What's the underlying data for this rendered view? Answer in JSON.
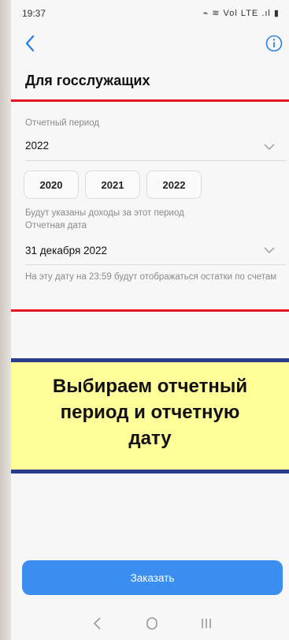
{
  "status_bar": {
    "time": "19:37",
    "icons": "⌁ ≋ Vol LTE .ıl ▮"
  },
  "header": {
    "title": "Для госслужащих"
  },
  "form": {
    "period_label": "Отчетный период",
    "period_value": "2022",
    "year_chips": [
      "2020",
      "2021",
      "2022"
    ],
    "period_hint": "Будут указаны доходы за этот период",
    "date_label": "Отчетная дата",
    "date_value": "31 декабря 2022",
    "date_hint": "На эту дату на 23:59 будут отображаться остатки по счетам"
  },
  "banner": {
    "text": "Выбираем отчетный\nпериод и отчетную\nдату"
  },
  "actions": {
    "order_label": "Заказать"
  },
  "colors": {
    "accent": "#3a8ef0",
    "highlight": "#e4151b",
    "banner_bg": "#ffff99",
    "banner_border": "#2c3b8c"
  }
}
